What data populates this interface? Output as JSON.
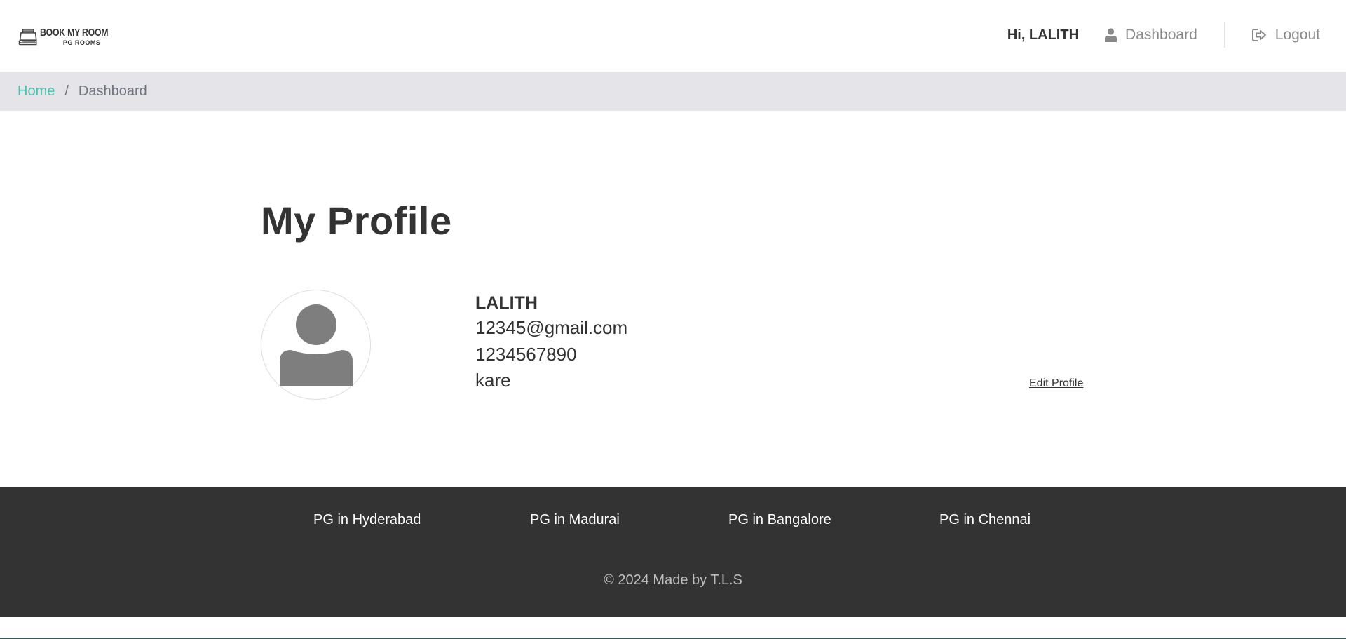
{
  "brand": {
    "title": "BOOK MY ROOM",
    "subtitle": "PG ROOMS",
    "icon": "bed-book-logo-icon"
  },
  "nav": {
    "greeting": "Hi, LALITH",
    "dashboard_label": "Dashboard",
    "logout_label": "Logout"
  },
  "breadcrumb": {
    "home": "Home",
    "separator": "/",
    "current": "Dashboard"
  },
  "profile": {
    "heading": "My Profile",
    "name": "LALITH",
    "email": "12345@gmail.com",
    "phone": "1234567890",
    "college": "kare",
    "edit_label": "Edit Profile",
    "avatar_icon": "user-avatar-icon"
  },
  "footer": {
    "links": [
      "PG in Hyderabad",
      "PG in Madurai",
      "PG in Bangalore",
      "PG in Chennai"
    ],
    "copyright": "© 2024 Made by T.L.S"
  },
  "colors": {
    "accent": "#4cbfae",
    "footer_bg": "#333333",
    "breadcrumb_bg": "#e5e4e8",
    "muted_text": "#8a8a8a"
  }
}
